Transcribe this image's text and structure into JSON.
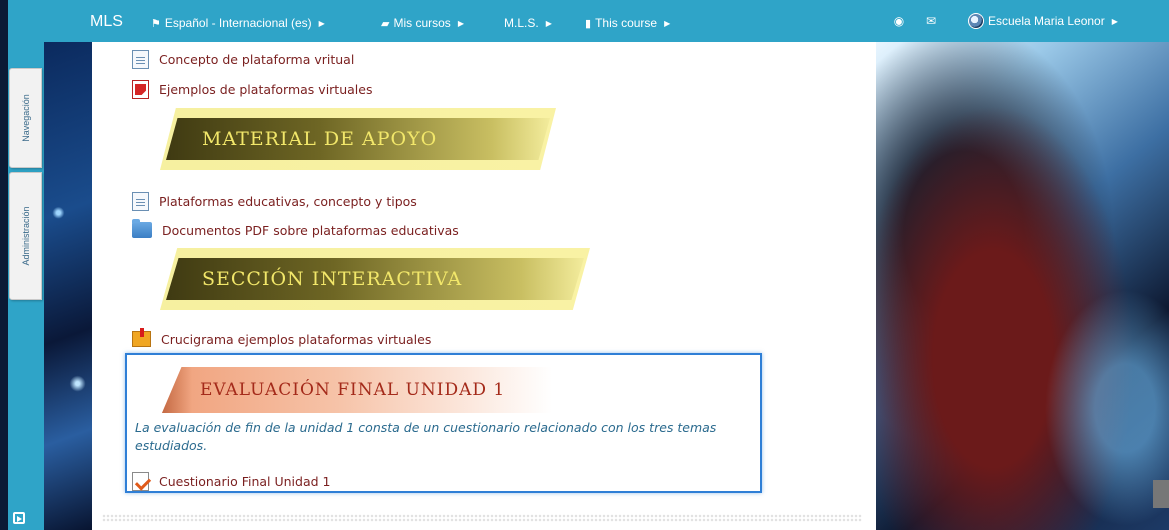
{
  "topbar": {
    "brand": "MLS",
    "language": "Español - Internacional (es)",
    "my_courses": "Mis cursos",
    "mls_menu": "M.L.S.",
    "this_course": "This course",
    "user": "Escuela Maria Leonor"
  },
  "sidebar": {
    "navigation_tab": "Navegación",
    "administration_tab": "Administración"
  },
  "content": {
    "items_top": [
      {
        "label": "Concepto de plataforma vritual",
        "icon": "document-icon"
      },
      {
        "label": "Ejemplos de plataformas virtuales",
        "icon": "pdf-icon"
      }
    ],
    "banner_material": "MATERIAL DE APOYO",
    "items_mid": [
      {
        "label": "Plataformas educativas, concepto y tipos",
        "icon": "document-icon"
      },
      {
        "label": "Documentos PDF sobre plataformas educativas",
        "icon": "folder-icon"
      }
    ],
    "banner_interactive": "SECCIÓN INTERACTIVA",
    "item_crossword": {
      "label": "Crucigrama ejemplos plataformas virtuales",
      "icon": "puzzle-icon"
    },
    "eval_banner": "EVALUACIÓN FINAL UNIDAD 1",
    "eval_description": "La evaluación de fin de la unidad 1 consta de un cuestionario relacionado con los tres temas estudiados.",
    "eval_quiz": {
      "label": "Cuestionario Final Unidad 1",
      "icon": "quiz-icon"
    }
  },
  "colors": {
    "topbar": "#2fa4c8",
    "link": "#7a1f1f",
    "highlight_border": "#2f7fd6",
    "description_text": "#2a6a8e"
  }
}
